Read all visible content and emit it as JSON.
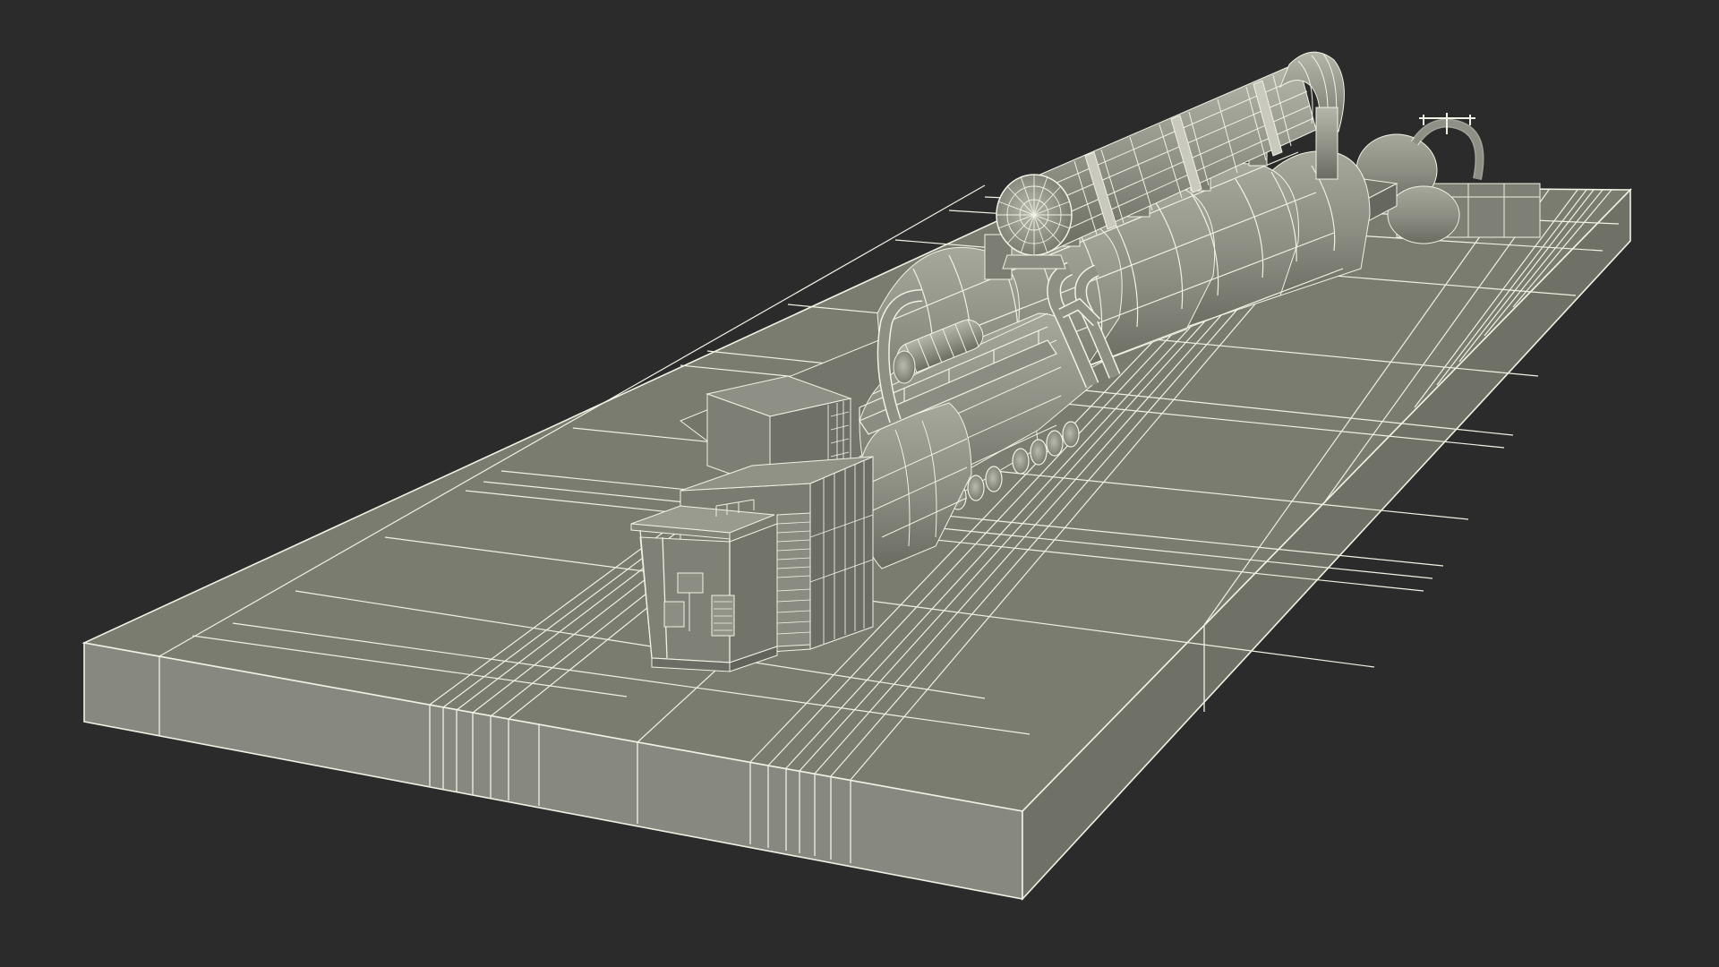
{
  "scene": {
    "subject": "steam-turbine-generator-wireframe",
    "view": "perspective",
    "render_mode": "clay-wireframe"
  },
  "colors": {
    "background": "#2b2b2b",
    "top_face": "#7a7c70",
    "side_face_front": "#8a8b80",
    "side_face_end": "#6f7066",
    "machine": "#8b8d82",
    "machine_dark": "#6d6f65",
    "machine_light": "#a3a599",
    "wire": "#f1f1e4"
  }
}
